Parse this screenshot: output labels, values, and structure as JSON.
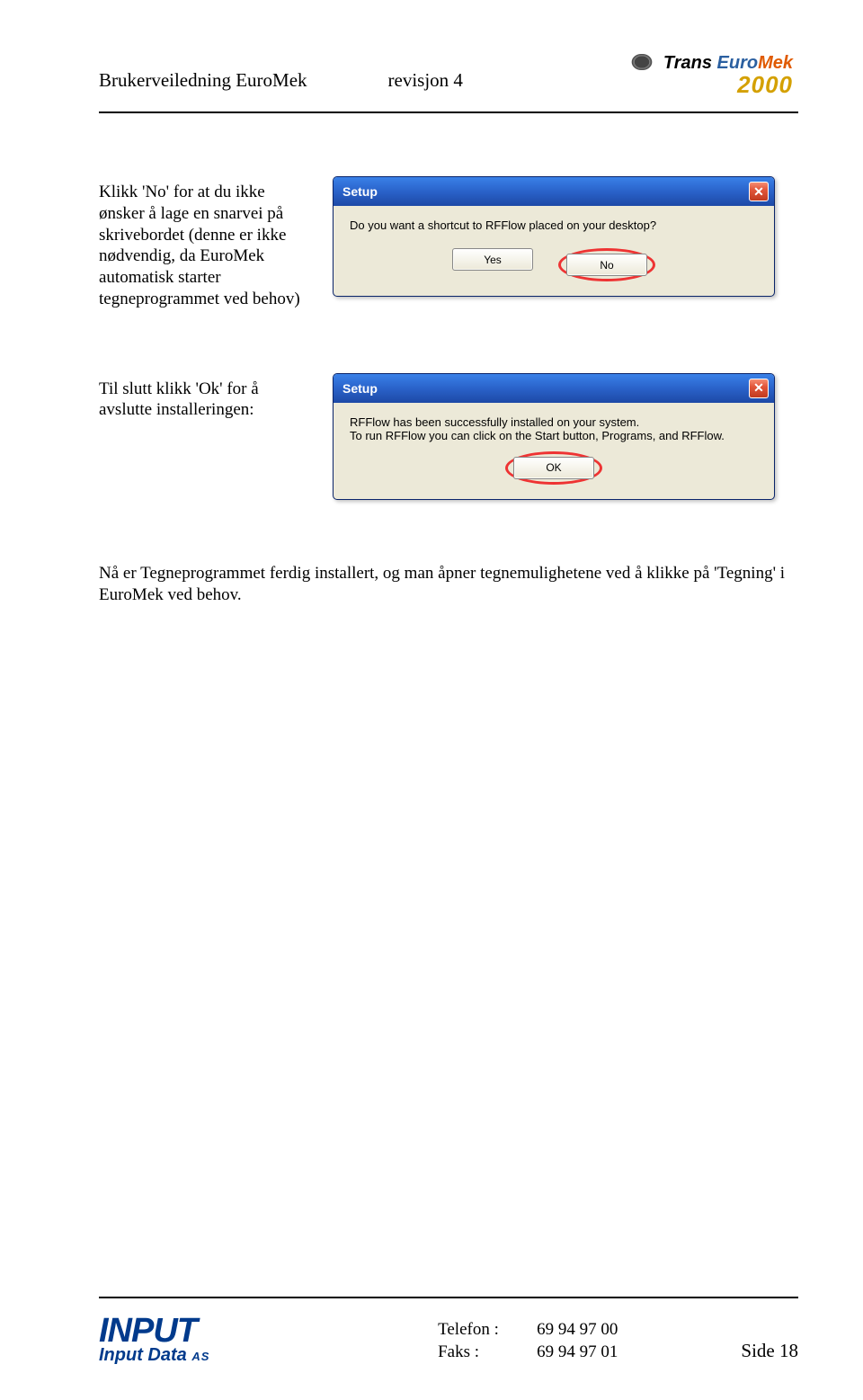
{
  "header": {
    "doc_title": "Brukerveiledning EuroMek",
    "revision": "revisjon 4",
    "logo_trans": "Trans",
    "logo_euro": "Euro",
    "logo_mek": "Mek",
    "logo_year": "2000"
  },
  "section1": {
    "instruction": "Klikk 'No' for at du ikke ønsker å lage en snarvei på skrivebordet (denne er ikke nødvendig, da EuroMek automatisk starter tegneprogrammet ved behov)",
    "dialog": {
      "title": "Setup",
      "message": "Do you want a shortcut to RFFlow placed on your desktop?",
      "yes": "Yes",
      "no": "No"
    }
  },
  "section2": {
    "instruction": "Til slutt klikk 'Ok' for å avslutte installeringen:",
    "dialog": {
      "title": "Setup",
      "line1": "RFFlow has been successfully installed on your system.",
      "line2": "To run RFFlow you can click on the Start button, Programs, and RFFlow.",
      "ok": "OK"
    }
  },
  "summary": "Nå er Tegneprogrammet ferdig installert, og man åpner tegnemulighetene ved å klikke på 'Tegning' i EuroMek ved behov.",
  "footer": {
    "logo_top": "INPUT",
    "logo_bottom": "Input Data",
    "logo_as": "AS",
    "phone_label": "Telefon :",
    "phone_value": "69 94 97 00",
    "fax_label": "Faks :",
    "fax_value": "69 94 97 01",
    "page": "Side 18"
  }
}
